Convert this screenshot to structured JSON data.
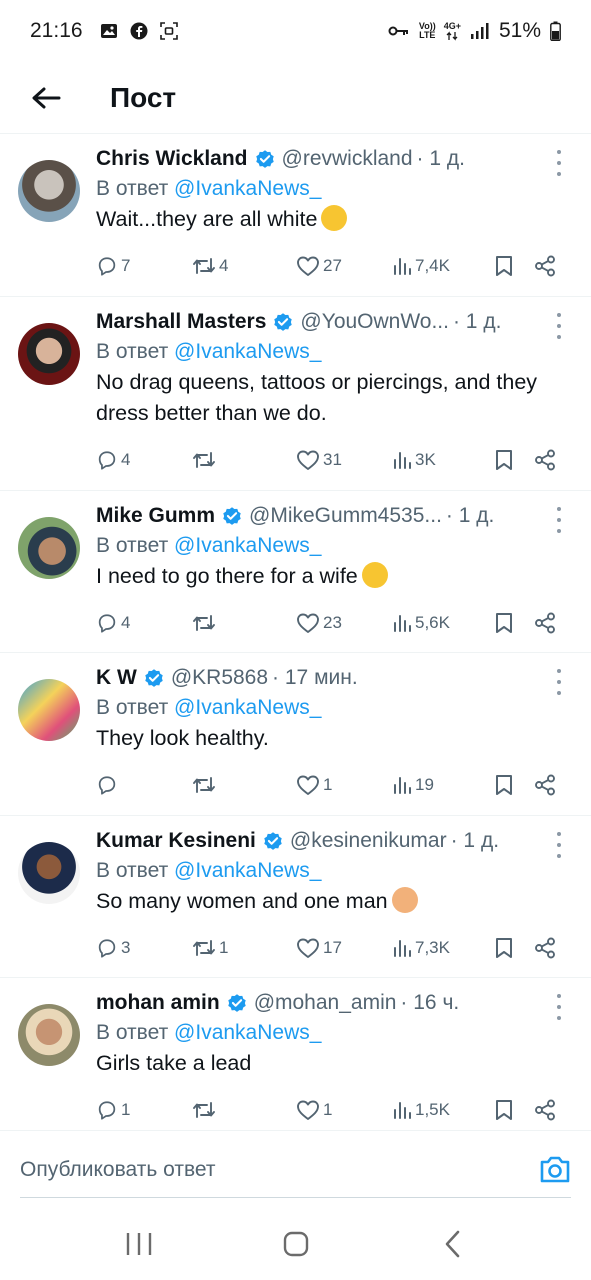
{
  "status_bar": {
    "time": "21:16",
    "battery": "51%",
    "volte_top": "Vo))",
    "volte_bottom": "LTE",
    "network": "4G+"
  },
  "header": {
    "title": "Пост"
  },
  "reply_prefix": "В ответ",
  "reply_target": "@IvankaNews_",
  "colors": {
    "accent": "#1d9bf0",
    "secondary_text": "#536471",
    "verified": "#1d9bf0"
  },
  "tweets": [
    {
      "name": "Chris Wickland",
      "handle": "@revwickland",
      "time": "· 1 д.",
      "text": "Wait...they are all white",
      "emoji": "smiling-face-with-sunglasses",
      "replies": "7",
      "retweets": "4",
      "likes": "27",
      "views": "7,4K"
    },
    {
      "name": "Marshall Masters",
      "handle": "@YouOwnWo...",
      "time": "· 1 д.",
      "text": "No drag queens, tattoos or piercings, and they dress better than we do.",
      "emoji": "",
      "replies": "4",
      "retweets": "",
      "likes": "31",
      "views": "3K"
    },
    {
      "name": "Mike Gumm",
      "handle": "@MikeGumm4535...",
      "time": "· 1 д.",
      "text": "I need to go there for a wife",
      "emoji": "smiling-face-with-heart-eyes",
      "replies": "4",
      "retweets": "",
      "likes": "23",
      "views": "5,6K"
    },
    {
      "name": "K W",
      "handle": "@KR5868",
      "time": "· 17 мин.",
      "text": "They look healthy.",
      "emoji": "",
      "replies": "",
      "retweets": "",
      "likes": "1",
      "views": "19"
    },
    {
      "name": "Kumar Kesineni",
      "handle": "@kesinenikumar",
      "time": "· 1 д.",
      "text": "So many women and one man",
      "emoji": "boy",
      "replies": "3",
      "retweets": "1",
      "likes": "17",
      "views": "7,3K"
    },
    {
      "name": "mohan amin",
      "handle": "@mohan_amin",
      "time": "· 16 ч.",
      "text": "Girls take a lead",
      "emoji": "",
      "replies": "1",
      "retweets": "",
      "likes": "1",
      "views": "1,5K"
    }
  ],
  "compose": {
    "placeholder": "Опубликовать ответ"
  }
}
